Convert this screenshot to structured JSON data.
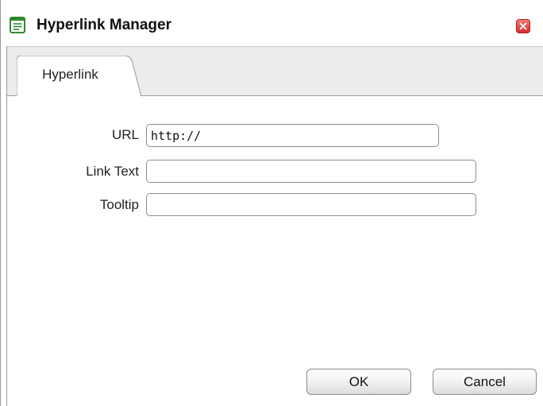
{
  "window": {
    "title": "Hyperlink Manager",
    "app_icon": "document-lines-icon",
    "close_icon": "close-icon",
    "close_color": "#d42d2d"
  },
  "tabs": [
    {
      "label": "Hyperlink",
      "active": true
    }
  ],
  "form": {
    "url": {
      "label": "URL",
      "value": "http://",
      "placeholder": ""
    },
    "link_text": {
      "label": "Link Text",
      "value": "",
      "placeholder": ""
    },
    "tooltip": {
      "label": "Tooltip",
      "value": "",
      "placeholder": ""
    }
  },
  "buttons": {
    "ok_label": "OK",
    "cancel_label": "Cancel"
  }
}
